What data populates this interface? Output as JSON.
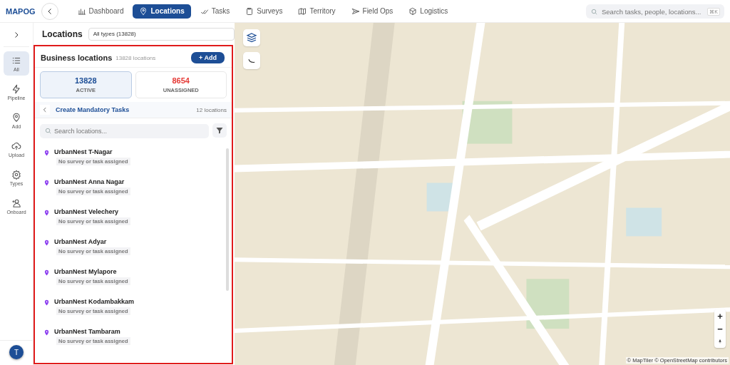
{
  "brand": {
    "logo": "MAPOG"
  },
  "nav": [
    {
      "label": "Dashboard",
      "kind": "chart",
      "selected": false
    },
    {
      "label": "Locations",
      "kind": "pin",
      "selected": true
    },
    {
      "label": "Tasks",
      "kind": "check",
      "selected": false
    },
    {
      "label": "Surveys",
      "kind": "clipboard",
      "selected": false
    },
    {
      "label": "Territory",
      "kind": "map",
      "selected": false
    },
    {
      "label": "Field Ops",
      "kind": "send",
      "selected": false
    },
    {
      "label": "Logistics",
      "kind": "box",
      "selected": false
    }
  ],
  "search": {
    "placeholder": "Search tasks, people, locations...",
    "shortcut": "⌘K"
  },
  "rail": [
    {
      "label": "All",
      "kind": "list",
      "selected": true
    },
    {
      "label": "Pipeline",
      "kind": "bolt",
      "selected": false
    },
    {
      "label": "Add",
      "kind": "pin",
      "selected": false
    },
    {
      "label": "Upload",
      "kind": "cloud",
      "selected": false
    },
    {
      "label": "Types",
      "kind": "gear",
      "selected": false
    },
    {
      "label": "Onboard",
      "kind": "user",
      "selected": false
    }
  ],
  "avatar": "T",
  "header": {
    "title": "Locations",
    "filter": "All types (13828)"
  },
  "panel": {
    "title": "Business locations",
    "count": "13828 locations",
    "add": "+ Add"
  },
  "stats": [
    {
      "value": "13828",
      "label": "ACTIVE",
      "color": "#1d4e96",
      "selected": true
    },
    {
      "value": "8654",
      "label": "UNASSIGNED",
      "color": "#e53935",
      "selected": false
    }
  ],
  "group": {
    "title": "Create Mandatory Tasks",
    "count": "12 locations"
  },
  "list_search": {
    "placeholder": "Search locations..."
  },
  "locations": [
    {
      "name": "UrbanNest T-Nagar",
      "status": "No survey or task assigned"
    },
    {
      "name": "UrbanNest Anna Nagar",
      "status": "No survey or task assigned"
    },
    {
      "name": "UrbanNest Velechery",
      "status": "No survey or task assigned"
    },
    {
      "name": "UrbanNest Adyar",
      "status": "No survey or task assigned"
    },
    {
      "name": "UrbanNest Mylapore",
      "status": "No survey or task assigned"
    },
    {
      "name": "UrbanNest Kodambakkam",
      "status": "No survey or task assigned"
    },
    {
      "name": "UrbanNest Tambaram",
      "status": "No survey or task assigned"
    }
  ],
  "map": {
    "kind": "picture",
    "zoom_in": "+",
    "zoom_out": "−",
    "attribution": "© MapTiler © OpenStreetMap contributors"
  }
}
